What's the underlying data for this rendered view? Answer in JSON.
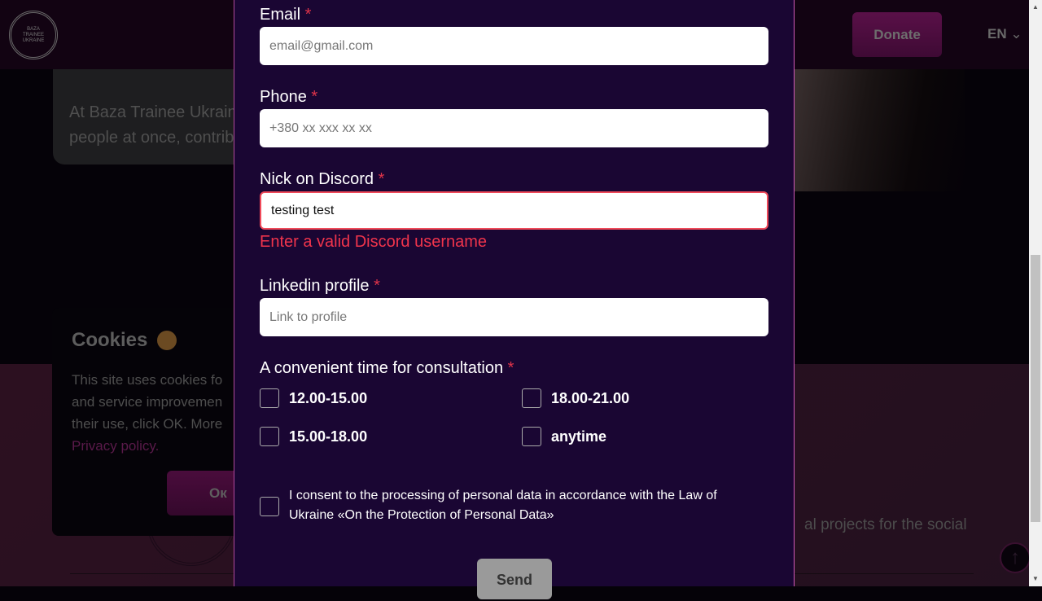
{
  "header": {
    "logo_text": [
      "BAZA",
      "TRAINEE",
      "UKRAINE"
    ],
    "donate_label": "Donate",
    "language": "EN"
  },
  "background": {
    "about_text_line1": "At Baza Trainee Ukraine",
    "about_text_line2": "people at once, contrib",
    "lower_text": "al projects for the social"
  },
  "cookies": {
    "title": "Cookies",
    "line1": "This site uses cookies fo",
    "line2": "and service improvemen",
    "line3": "their use, click OK. More",
    "privacy_link": "Privacy policy.",
    "ok_label": "Ок"
  },
  "form": {
    "email": {
      "label": "Email",
      "required": "*",
      "placeholder": "email@gmail.com",
      "value": ""
    },
    "phone": {
      "label": "Phone",
      "required": "*",
      "placeholder": "+380 xx xxx xx xx",
      "value": ""
    },
    "discord": {
      "label": "Nick on Discord",
      "required": "*",
      "value": "testing test",
      "error": "Enter a valid Discord username"
    },
    "linkedin": {
      "label": "Linkedin profile",
      "required": "*",
      "placeholder": "Link to profile",
      "value": ""
    },
    "time": {
      "label": "A convenient time for consultation",
      "required": "*",
      "options": [
        {
          "label": "12.00-15.00",
          "checked": false
        },
        {
          "label": "18.00-21.00",
          "checked": false
        },
        {
          "label": "15.00-18.00",
          "checked": false
        },
        {
          "label": "anytime",
          "checked": false
        }
      ]
    },
    "consent": {
      "text": "I consent to the processing of personal data in accordance with the Law of Ukraine «On the Protection of Personal Data»",
      "checked": false
    },
    "send_label": "Send"
  },
  "colors": {
    "modal_bg": "#1a0633",
    "error": "#f0344c",
    "accent": "#d05ab8"
  }
}
